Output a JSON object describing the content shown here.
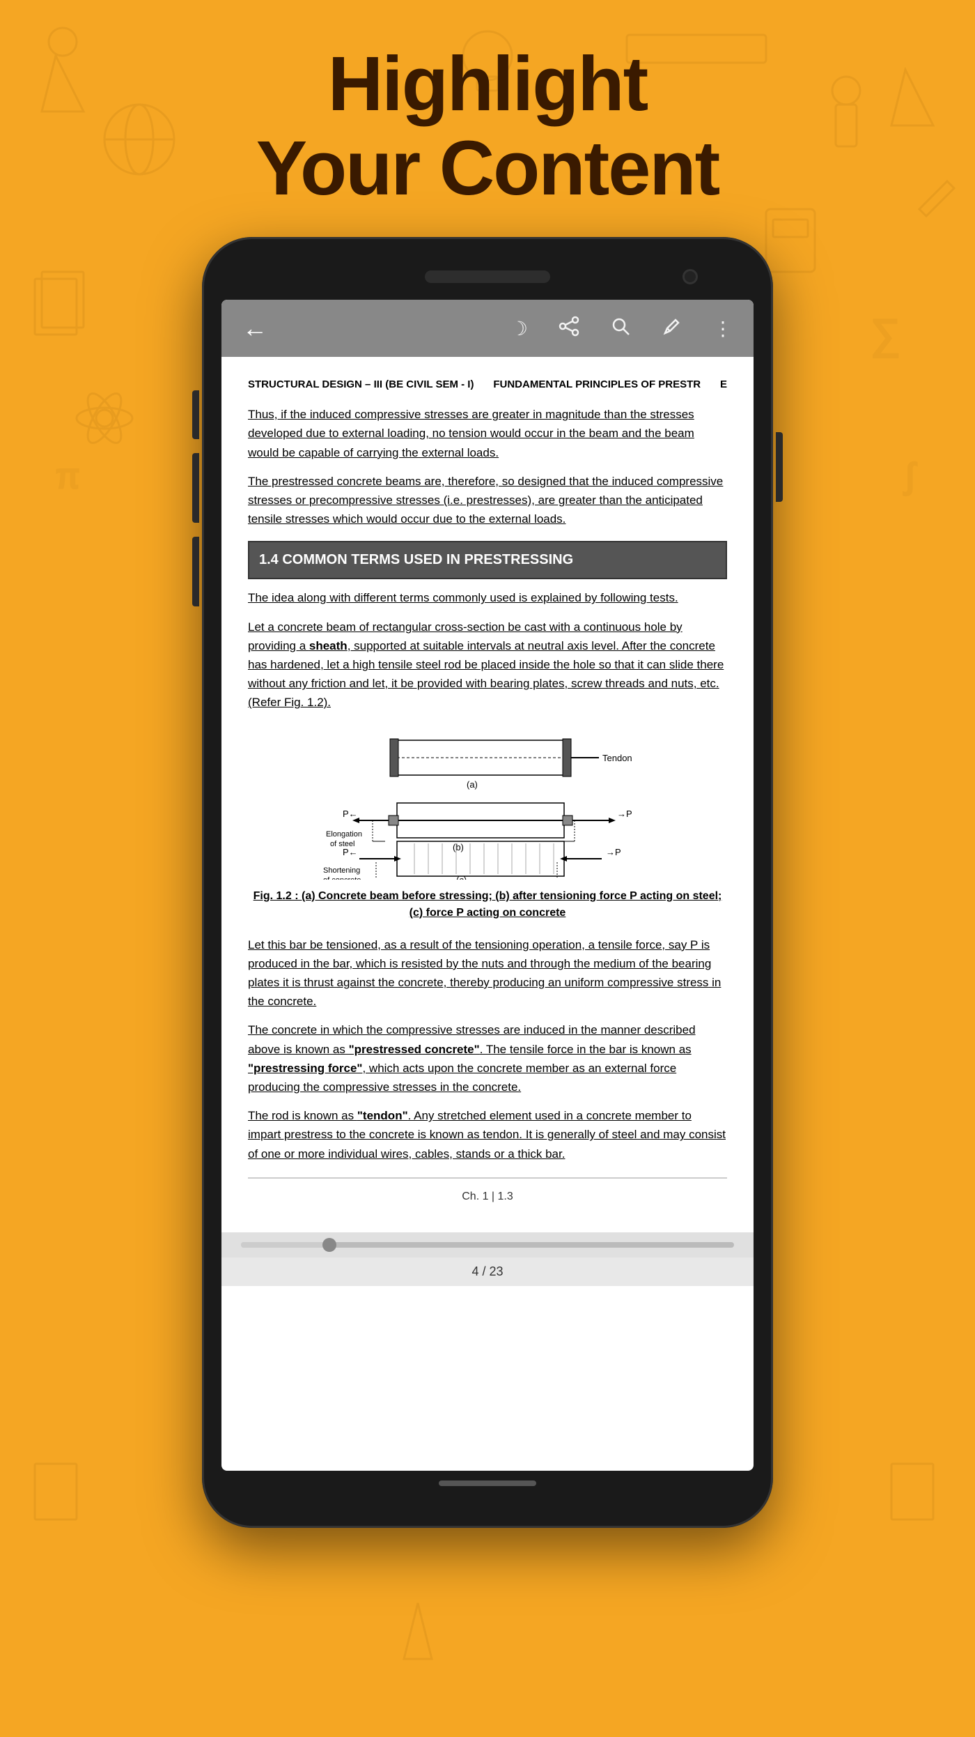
{
  "hero": {
    "line1": "Highlight",
    "line2": "Your Content"
  },
  "toolbar": {
    "back_icon": "←",
    "moon_icon": "☽",
    "share_icon": "⊲",
    "search_icon": "⌕",
    "pen_icon": "✎",
    "more_icon": "⋮"
  },
  "document": {
    "header_left": "STRUCTURAL DESIGN – III (BE CIVIL SEM - I)",
    "header_right": "FUNDAMENTAL PRINCIPLES OF PRESTR",
    "header_page": "E",
    "para1": "Thus, if the induced compressive stresses are greater in magnitude than the stresses developed due to external loading, no tension would occur in the beam and the beam would be capable of carrying the external loads.",
    "para2": "The prestressed concrete beams are, therefore, so designed that the induced compressive stresses or precompressive stresses (i.e. prestresses), are greater than the anticipated tensile stresses which would occur due to the external loads.",
    "section_heading": "1.4  COMMON TERMS USED IN PRESTRESSING",
    "intro_line": "The idea along with different terms commonly used is explained by following tests.",
    "body_para": "Let a concrete beam of rectangular cross-section be cast with a continuous hole by providing a sheath, supported at suitable intervals at neutral axis level. After the concrete has hardened, let a high tensile steel rod be placed inside the hole so that it can slide there without any friction and let, it be provided with bearing plates, screw threads and nuts, etc. (Refer Fig. 1.2).",
    "diagram": {
      "label_a": "(a)",
      "label_tendon": "Tendon",
      "label_b": "(b)",
      "label_c": "(c)",
      "label_p_left": "P←",
      "label_p_right": "→P",
      "label_elongation": "Elongation\nof steel",
      "label_shortening": "Shortening\nof concrete",
      "caption": "Fig. 1.2 : (a) Concrete beam before stressing;  (b) after tensioning force P acting on steel; (c) force P acting on concrete"
    },
    "para_tensioned": "Let this bar be tensioned, as a result of the tensioning operation, a tensile force, say P is produced in the bar, which is resisted by the nuts and through the medium of the bearing plates it is thrust against the concrete, thereby producing an uniform compressive stress in the concrete.",
    "para_prestressed": "The concrete in which the compressive stresses are induced in the manner described above is known as \"prestressed concrete\". The tensile force in the bar is known as \"prestressing force\", which acts upon the concrete member as an external force producing the compressive stresses in the concrete.",
    "para_tendon": "The rod is known as \"tendon\". Any stretched element used in a concrete member to impart prestress to the concrete is known as tendon. It is generally of steel and may consist of one or more individual wires, cables, stands or a thick bar.",
    "chapter_ref": "Ch. 1 | 1.3",
    "page_indicator": "4 / 23"
  }
}
